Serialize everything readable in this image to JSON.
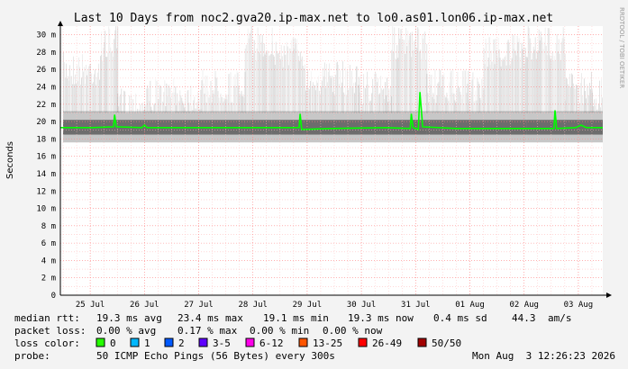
{
  "chart_data": {
    "type": "line",
    "title": "Last 10 Days from noc2.gva20.ip-max.net to lo0.as01.lon06.ip-max.net",
    "ylabel": "Seconds",
    "xlabel": "",
    "ylim": [
      0,
      31
    ],
    "y_ticks": [
      {
        "v": 0,
        "label": "0"
      },
      {
        "v": 2,
        "label": "2 m"
      },
      {
        "v": 4,
        "label": "4 m"
      },
      {
        "v": 6,
        "label": "6 m"
      },
      {
        "v": 8,
        "label": "8 m"
      },
      {
        "v": 10,
        "label": "10 m"
      },
      {
        "v": 12,
        "label": "12 m"
      },
      {
        "v": 14,
        "label": "14 m"
      },
      {
        "v": 16,
        "label": "16 m"
      },
      {
        "v": 18,
        "label": "18 m"
      },
      {
        "v": 20,
        "label": "20 m"
      },
      {
        "v": 22,
        "label": "22 m"
      },
      {
        "v": 24,
        "label": "24 m"
      },
      {
        "v": 26,
        "label": "26 m"
      },
      {
        "v": 28,
        "label": "28 m"
      },
      {
        "v": 30,
        "label": "30 m"
      }
    ],
    "x_ticks": [
      "25 Jul",
      "26 Jul",
      "27 Jul",
      "28 Jul",
      "29 Jul",
      "30 Jul",
      "31 Jul",
      "01 Aug",
      "02 Aug",
      "03 Aug"
    ],
    "xlim_days": [
      0,
      10
    ],
    "grid": true,
    "median_series": {
      "color": "#00ff00",
      "points": [
        [
          0.0,
          19.3
        ],
        [
          0.6,
          19.3
        ],
        [
          0.98,
          19.4
        ],
        [
          1.0,
          20.8
        ],
        [
          1.03,
          19.4
        ],
        [
          1.5,
          19.3
        ],
        [
          1.55,
          19.6
        ],
        [
          1.6,
          19.3
        ],
        [
          2.4,
          19.3
        ],
        [
          3.0,
          19.3
        ],
        [
          4.4,
          19.3
        ],
        [
          4.42,
          20.9
        ],
        [
          4.45,
          19.1
        ],
        [
          5.0,
          19.2
        ],
        [
          6.0,
          19.3
        ],
        [
          6.45,
          19.2
        ],
        [
          6.47,
          20.9
        ],
        [
          6.5,
          19.3
        ],
        [
          6.6,
          19.1
        ],
        [
          6.63,
          23.4
        ],
        [
          6.68,
          19.4
        ],
        [
          7.3,
          19.2
        ],
        [
          8.0,
          19.2
        ],
        [
          9.1,
          19.2
        ],
        [
          9.12,
          21.3
        ],
        [
          9.15,
          19.2
        ],
        [
          9.5,
          19.3
        ],
        [
          9.6,
          19.6
        ],
        [
          9.7,
          19.3
        ],
        [
          10.0,
          19.3
        ]
      ]
    },
    "smoke_bands": [
      {
        "from": 0.05,
        "to": 0.75,
        "max": 28
      },
      {
        "from": 0.75,
        "to": 1.05,
        "max": 31
      },
      {
        "from": 1.05,
        "to": 1.55,
        "max": 24
      },
      {
        "from": 1.55,
        "to": 2.6,
        "max": 25
      },
      {
        "from": 2.6,
        "to": 3.4,
        "max": 26
      },
      {
        "from": 3.4,
        "to": 3.9,
        "max": 31
      },
      {
        "from": 3.9,
        "to": 4.5,
        "max": 30
      },
      {
        "from": 4.5,
        "to": 5.5,
        "max": 27
      },
      {
        "from": 5.5,
        "to": 6.1,
        "max": 26
      },
      {
        "from": 6.1,
        "to": 6.75,
        "max": 31
      },
      {
        "from": 6.75,
        "to": 7.8,
        "max": 26
      },
      {
        "from": 7.8,
        "to": 8.6,
        "max": 30
      },
      {
        "from": 8.6,
        "to": 9.3,
        "max": 31
      },
      {
        "from": 9.3,
        "to": 9.8,
        "max": 26
      },
      {
        "from": 9.8,
        "to": 10.0,
        "max": 25
      }
    ]
  },
  "stats": {
    "median_rtt": {
      "label": "median rtt:",
      "avg": "19.3 ms avg",
      "max": "23.4 ms max",
      "min": "19.1 ms min",
      "now": "19.3 ms now",
      "sd": "0.4 ms sd",
      "ams": "44.3",
      "ams_unit": "am/s"
    },
    "packet_loss": {
      "label": "packet loss:",
      "avg": "0.00 % avg",
      "max": "0.17 % max",
      "min": "0.00 % min",
      "now": "0.00 % now"
    },
    "loss_color": {
      "label": "loss color:",
      "items": [
        {
          "label": "0",
          "color": "#26ff00"
        },
        {
          "label": "1",
          "color": "#00b8ff"
        },
        {
          "label": "2",
          "color": "#0059ff"
        },
        {
          "label": "3-5",
          "color": "#5e00ff"
        },
        {
          "label": "6-12",
          "color": "#ff00e9"
        },
        {
          "label": "13-25",
          "color": "#ff5500"
        },
        {
          "label": "26-49",
          "color": "#ff0000"
        },
        {
          "label": "50/50",
          "color": "#a10000"
        }
      ]
    },
    "probe": {
      "label": "probe:",
      "text": "50 ICMP Echo Pings (56 Bytes) every 300s",
      "timestamp": "Mon Aug  3 12:26:23 2026"
    }
  },
  "watermark": "RRDTOOL / TOBI OETIKER"
}
